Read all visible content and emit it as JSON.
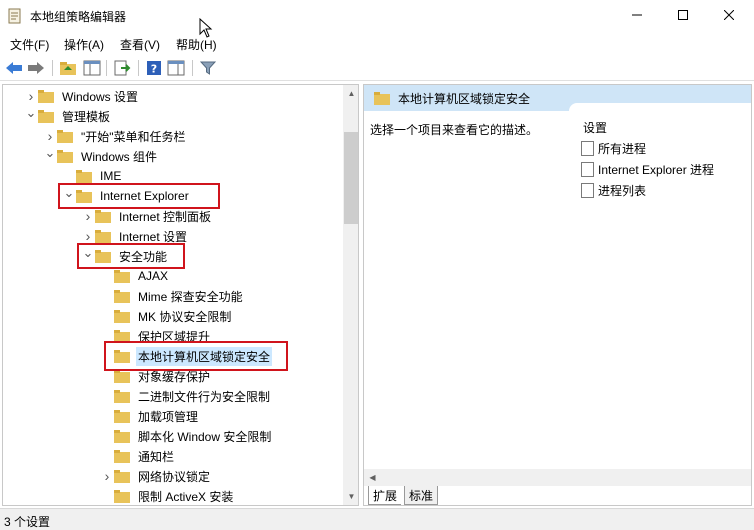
{
  "window": {
    "title": "本地组策略编辑器"
  },
  "menu": [
    "文件(F)",
    "操作(A)",
    "查看(V)",
    "帮助(H)"
  ],
  "toolbar": {
    "icons": [
      "back-icon",
      "forward-icon",
      "up-folder-icon",
      "show-hide-tree-icon",
      "export-list-icon",
      "help-icon",
      "properties-view-icon",
      "filter-icon"
    ]
  },
  "tree": [
    {
      "label": "Windows 设置",
      "expander": "collapsed",
      "selected": false
    },
    {
      "label": "管理模板",
      "expander": "expanded",
      "selected": false
    },
    {
      "label": "\"开始\"菜单和任务栏",
      "expander": "collapsed",
      "selected": false
    },
    {
      "label": "Windows 组件",
      "expander": "expanded",
      "selected": false
    },
    {
      "label": "IME",
      "expander": "none",
      "selected": false
    },
    {
      "label": "Internet Explorer",
      "expander": "expanded",
      "selected": false
    },
    {
      "label": "Internet 控制面板",
      "expander": "collapsed",
      "selected": false
    },
    {
      "label": "Internet 设置",
      "expander": "collapsed",
      "selected": false
    },
    {
      "label": "安全功能",
      "expander": "expanded",
      "selected": false
    },
    {
      "label": "AJAX",
      "expander": "none",
      "selected": false
    },
    {
      "label": "Mime 探查安全功能",
      "expander": "none",
      "selected": false
    },
    {
      "label": "MK 协议安全限制",
      "expander": "none",
      "selected": false
    },
    {
      "label": "保护区域提升",
      "expander": "none",
      "selected": false
    },
    {
      "label": "本地计算机区域锁定安全",
      "expander": "none",
      "selected": true
    },
    {
      "label": "对象缓存保护",
      "expander": "none",
      "selected": false
    },
    {
      "label": "二进制文件行为安全限制",
      "expander": "none",
      "selected": false
    },
    {
      "label": "加载项管理",
      "expander": "none",
      "selected": false
    },
    {
      "label": "脚本化 Window 安全限制",
      "expander": "none",
      "selected": false
    },
    {
      "label": "通知栏",
      "expander": "none",
      "selected": false
    },
    {
      "label": "网络协议锁定",
      "expander": "collapsed",
      "selected": false
    },
    {
      "label": "限制 ActiveX 安装",
      "expander": "none",
      "selected": false
    }
  ],
  "right_pane": {
    "header": "本地计算机区域锁定安全",
    "description": "选择一个项目来查看它的描述。",
    "column_header": "设置",
    "items": [
      "所有进程",
      "Internet Explorer 进程",
      "进程列表"
    ]
  },
  "tabs": [
    "扩展",
    "标准"
  ],
  "status": "3 个设置",
  "colors": {
    "highlight_box": "#d0141c",
    "selection": "#cce8ff",
    "header_bg": "#cfe5f7",
    "folder": "#e8c35a"
  }
}
